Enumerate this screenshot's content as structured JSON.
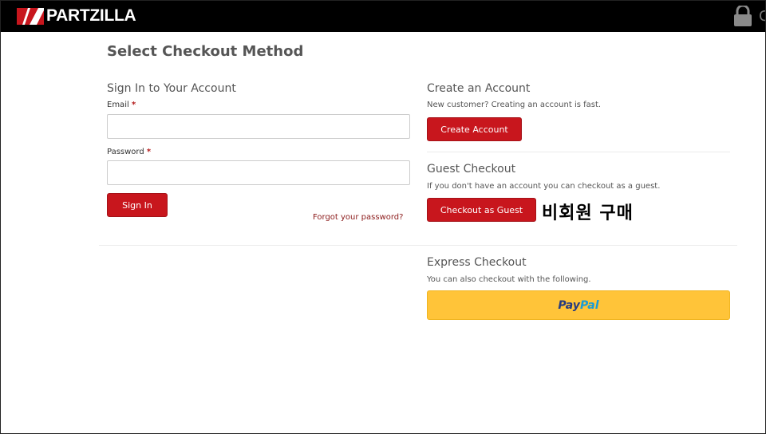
{
  "header": {
    "brand": "PARTZILLA",
    "cut_off_text": "C"
  },
  "page": {
    "title": "Select Checkout Method"
  },
  "sign_in": {
    "title": "Sign In to Your Account",
    "email_label": "Email",
    "password_label": "Password",
    "required_mark": "*",
    "email_value": "",
    "password_value": "",
    "sign_in_button": "Sign In",
    "forgot_link": "Forgot your password?"
  },
  "create_account": {
    "title": "Create an Account",
    "description": "New customer? Creating an account is fast.",
    "button": "Create Account"
  },
  "guest": {
    "title": "Guest Checkout",
    "description": "If you don't have an account you can checkout as a guest.",
    "button": "Checkout as Guest",
    "annotation": "비회원 구매"
  },
  "express": {
    "title": "Express Checkout",
    "description": "You can also checkout with the following.",
    "paypal_part1": "Pay",
    "paypal_part2": "Pal"
  },
  "colors": {
    "brand_red": "#c8161d",
    "header_bg": "#000000",
    "paypal_yellow": "#ffc439",
    "paypal_navy": "#253b80",
    "paypal_blue": "#179bd7"
  }
}
